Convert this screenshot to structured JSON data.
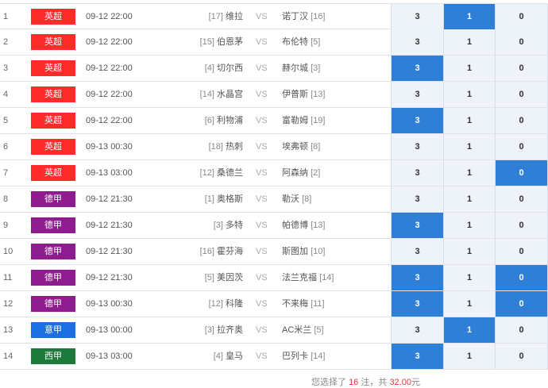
{
  "colors": {
    "epl": "#ff2b2b",
    "bundesliga": "#8f1c8f",
    "seriea": "#1c6fe0",
    "laliga": "#1e7a3a",
    "selected": "#2f7fd6",
    "unselected": "#eef3fa"
  },
  "options": [
    "3",
    "1",
    "0"
  ],
  "matches": [
    {
      "num": "1",
      "league": "英超",
      "league_key": "epl",
      "time": "09-12 22:00",
      "home_rank": "[17]",
      "home": "维拉",
      "vs": "VS",
      "away": "诺丁汉",
      "away_rank": "[16]",
      "sel": [
        false,
        true,
        false
      ]
    },
    {
      "num": "2",
      "league": "英超",
      "league_key": "epl",
      "time": "09-12 22:00",
      "home_rank": "[15]",
      "home": "伯恩茅",
      "vs": "VS",
      "away": "布伦特",
      "away_rank": "[5]",
      "sel": [
        false,
        false,
        false
      ]
    },
    {
      "num": "3",
      "league": "英超",
      "league_key": "epl",
      "time": "09-12 22:00",
      "home_rank": "[4]",
      "home": "切尔西",
      "vs": "VS",
      "away": "赫尔城",
      "away_rank": "[3]",
      "sel": [
        true,
        false,
        false
      ]
    },
    {
      "num": "4",
      "league": "英超",
      "league_key": "epl",
      "time": "09-12 22:00",
      "home_rank": "[14]",
      "home": "水晶宫",
      "vs": "VS",
      "away": "伊普斯",
      "away_rank": "[13]",
      "sel": [
        false,
        false,
        false
      ]
    },
    {
      "num": "5",
      "league": "英超",
      "league_key": "epl",
      "time": "09-12 22:00",
      "home_rank": "[6]",
      "home": "利物浦",
      "vs": "VS",
      "away": "富勒姆",
      "away_rank": "[19]",
      "sel": [
        true,
        false,
        false
      ]
    },
    {
      "num": "6",
      "league": "英超",
      "league_key": "epl",
      "time": "09-13 00:30",
      "home_rank": "[18]",
      "home": "热刺",
      "vs": "VS",
      "away": "埃弗顿",
      "away_rank": "[8]",
      "sel": [
        false,
        false,
        false
      ]
    },
    {
      "num": "7",
      "league": "英超",
      "league_key": "epl",
      "time": "09-13 03:00",
      "home_rank": "[12]",
      "home": "桑德兰",
      "vs": "VS",
      "away": "阿森纳",
      "away_rank": "[2]",
      "sel": [
        false,
        false,
        true
      ]
    },
    {
      "num": "8",
      "league": "德甲",
      "league_key": "bundesliga",
      "time": "09-12 21:30",
      "home_rank": "[1]",
      "home": "奥格斯",
      "vs": "VS",
      "away": "勒沃",
      "away_rank": "[8]",
      "sel": [
        false,
        false,
        false
      ]
    },
    {
      "num": "9",
      "league": "德甲",
      "league_key": "bundesliga",
      "time": "09-12 21:30",
      "home_rank": "[3]",
      "home": "多特",
      "vs": "VS",
      "away": "帕德博",
      "away_rank": "[13]",
      "sel": [
        true,
        false,
        false
      ]
    },
    {
      "num": "10",
      "league": "德甲",
      "league_key": "bundesliga",
      "time": "09-12 21:30",
      "home_rank": "[16]",
      "home": "霍芬海",
      "vs": "VS",
      "away": "斯图加",
      "away_rank": "[10]",
      "sel": [
        false,
        false,
        false
      ]
    },
    {
      "num": "11",
      "league": "德甲",
      "league_key": "bundesliga",
      "time": "09-12 21:30",
      "home_rank": "[5]",
      "home": "美因茨",
      "vs": "VS",
      "away": "法兰克福",
      "away_rank": "[14]",
      "sel": [
        true,
        false,
        true
      ]
    },
    {
      "num": "12",
      "league": "德甲",
      "league_key": "bundesliga",
      "time": "09-13 00:30",
      "home_rank": "[12]",
      "home": "科隆",
      "vs": "VS",
      "away": "不来梅",
      "away_rank": "[11]",
      "sel": [
        true,
        false,
        true
      ]
    },
    {
      "num": "13",
      "league": "意甲",
      "league_key": "seriea",
      "time": "09-13 00:00",
      "home_rank": "[3]",
      "home": "拉齐奥",
      "vs": "VS",
      "away": "AC米兰",
      "away_rank": "[5]",
      "sel": [
        false,
        true,
        false
      ]
    },
    {
      "num": "14",
      "league": "西甲",
      "league_key": "laliga",
      "time": "09-13 03:00",
      "home_rank": "[4]",
      "home": "皇马",
      "vs": "VS",
      "away": "巴列卡",
      "away_rank": "[14]",
      "sel": [
        true,
        false,
        false
      ]
    }
  ],
  "summary": {
    "prefix": "您选择了 ",
    "count": "16",
    "mid": " 注，共 ",
    "amount": "32.00",
    "suffix": "元"
  }
}
